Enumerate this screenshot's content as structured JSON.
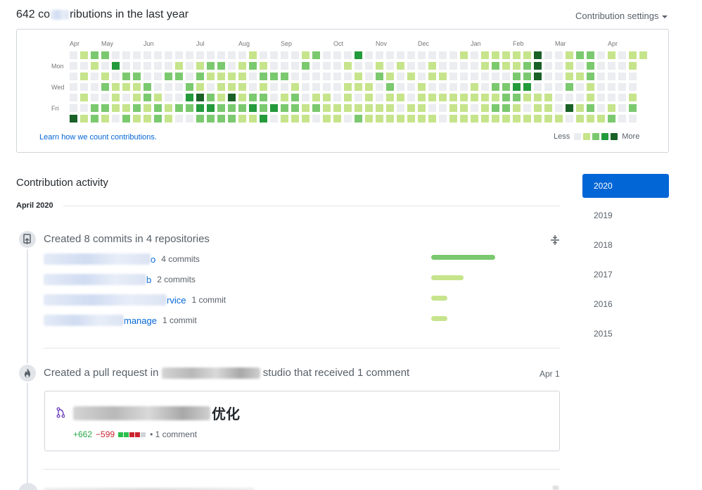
{
  "header": {
    "contrib_count": "642",
    "contrib_prefix_visible": "co",
    "contrib_suffix": "ributions in the last year",
    "settings_label": "Contribution settings"
  },
  "calendar": {
    "months": [
      {
        "label": "Apr",
        "col": 0
      },
      {
        "label": "May",
        "col": 3
      },
      {
        "label": "Jun",
        "col": 7
      },
      {
        "label": "Jul",
        "col": 12
      },
      {
        "label": "Aug",
        "col": 16
      },
      {
        "label": "Sep",
        "col": 20
      },
      {
        "label": "Oct",
        "col": 25
      },
      {
        "label": "Nov",
        "col": 29
      },
      {
        "label": "Dec",
        "col": 33
      },
      {
        "label": "Jan",
        "col": 38
      },
      {
        "label": "Feb",
        "col": 42
      },
      {
        "label": "Mar",
        "col": 46
      },
      {
        "label": "Apr",
        "col": 51
      }
    ],
    "day_labels": [
      {
        "label": "Mon",
        "row": 1
      },
      {
        "label": "Wed",
        "row": 3
      },
      {
        "label": "Fri",
        "row": 5
      }
    ],
    "level_colors": [
      "#ebedf0",
      "#c6e48b",
      "#7bc96f",
      "#239a3b",
      "#196127"
    ],
    "weeks": [
      "0000004",
      "1010101",
      "2100022",
      "2012021",
      "0301110",
      "0021012",
      "0021121",
      "0002211",
      "0000122",
      "0020011",
      "0120020",
      "0002320",
      "0121432",
      "0210232",
      "0211122",
      "0011422",
      "0111121",
      "1200231",
      "0121223",
      "0020030",
      "0020121",
      "0001221",
      "1200011",
      "2000120",
      "0000111",
      "0000011",
      "0101110",
      "3011012",
      "0001111",
      "0120011",
      "0012111",
      "0100101",
      "0010011",
      "0001111",
      "0110101",
      "0010100",
      "0000111",
      "1000111",
      "0001101",
      "1100111",
      "1202121",
      "1102221",
      "1123211",
      "1223101",
      "4440111",
      "0000111",
      "0000001",
      "1112040",
      "2010011",
      "2221121",
      "0000001",
      "1000012",
      "0000000",
      "1100120",
      "1"
    ],
    "learn_link": "Learn how we count contributions.",
    "legend_less": "Less",
    "legend_more": "More"
  },
  "activity": {
    "title": "Contribution activity",
    "month": "April 2020",
    "commits_event": {
      "title": "Created 8 commits in 4 repositories",
      "repos": [
        {
          "name_visible": "o",
          "count": "4 commits",
          "bar_fraction": 1.0
        },
        {
          "name_visible": "b",
          "count": "2 commits",
          "bar_fraction": 0.5
        },
        {
          "name_visible": "rvice",
          "count": "1 commit",
          "bar_fraction": 0.25
        },
        {
          "name_visible": "manage",
          "count": "1 commit",
          "bar_fraction": 0.25
        }
      ]
    },
    "pr_event": {
      "title_prefix": "Created a pull request in",
      "title_suffix": "studio that received 1 comment",
      "date": "Apr 1",
      "pr_title_visible": "优化",
      "additions": "+662",
      "deletions": "−599",
      "comments": "1 comment"
    }
  },
  "years": [
    "2020",
    "2019",
    "2018",
    "2017",
    "2016",
    "2015"
  ],
  "selected_year": "2020"
}
